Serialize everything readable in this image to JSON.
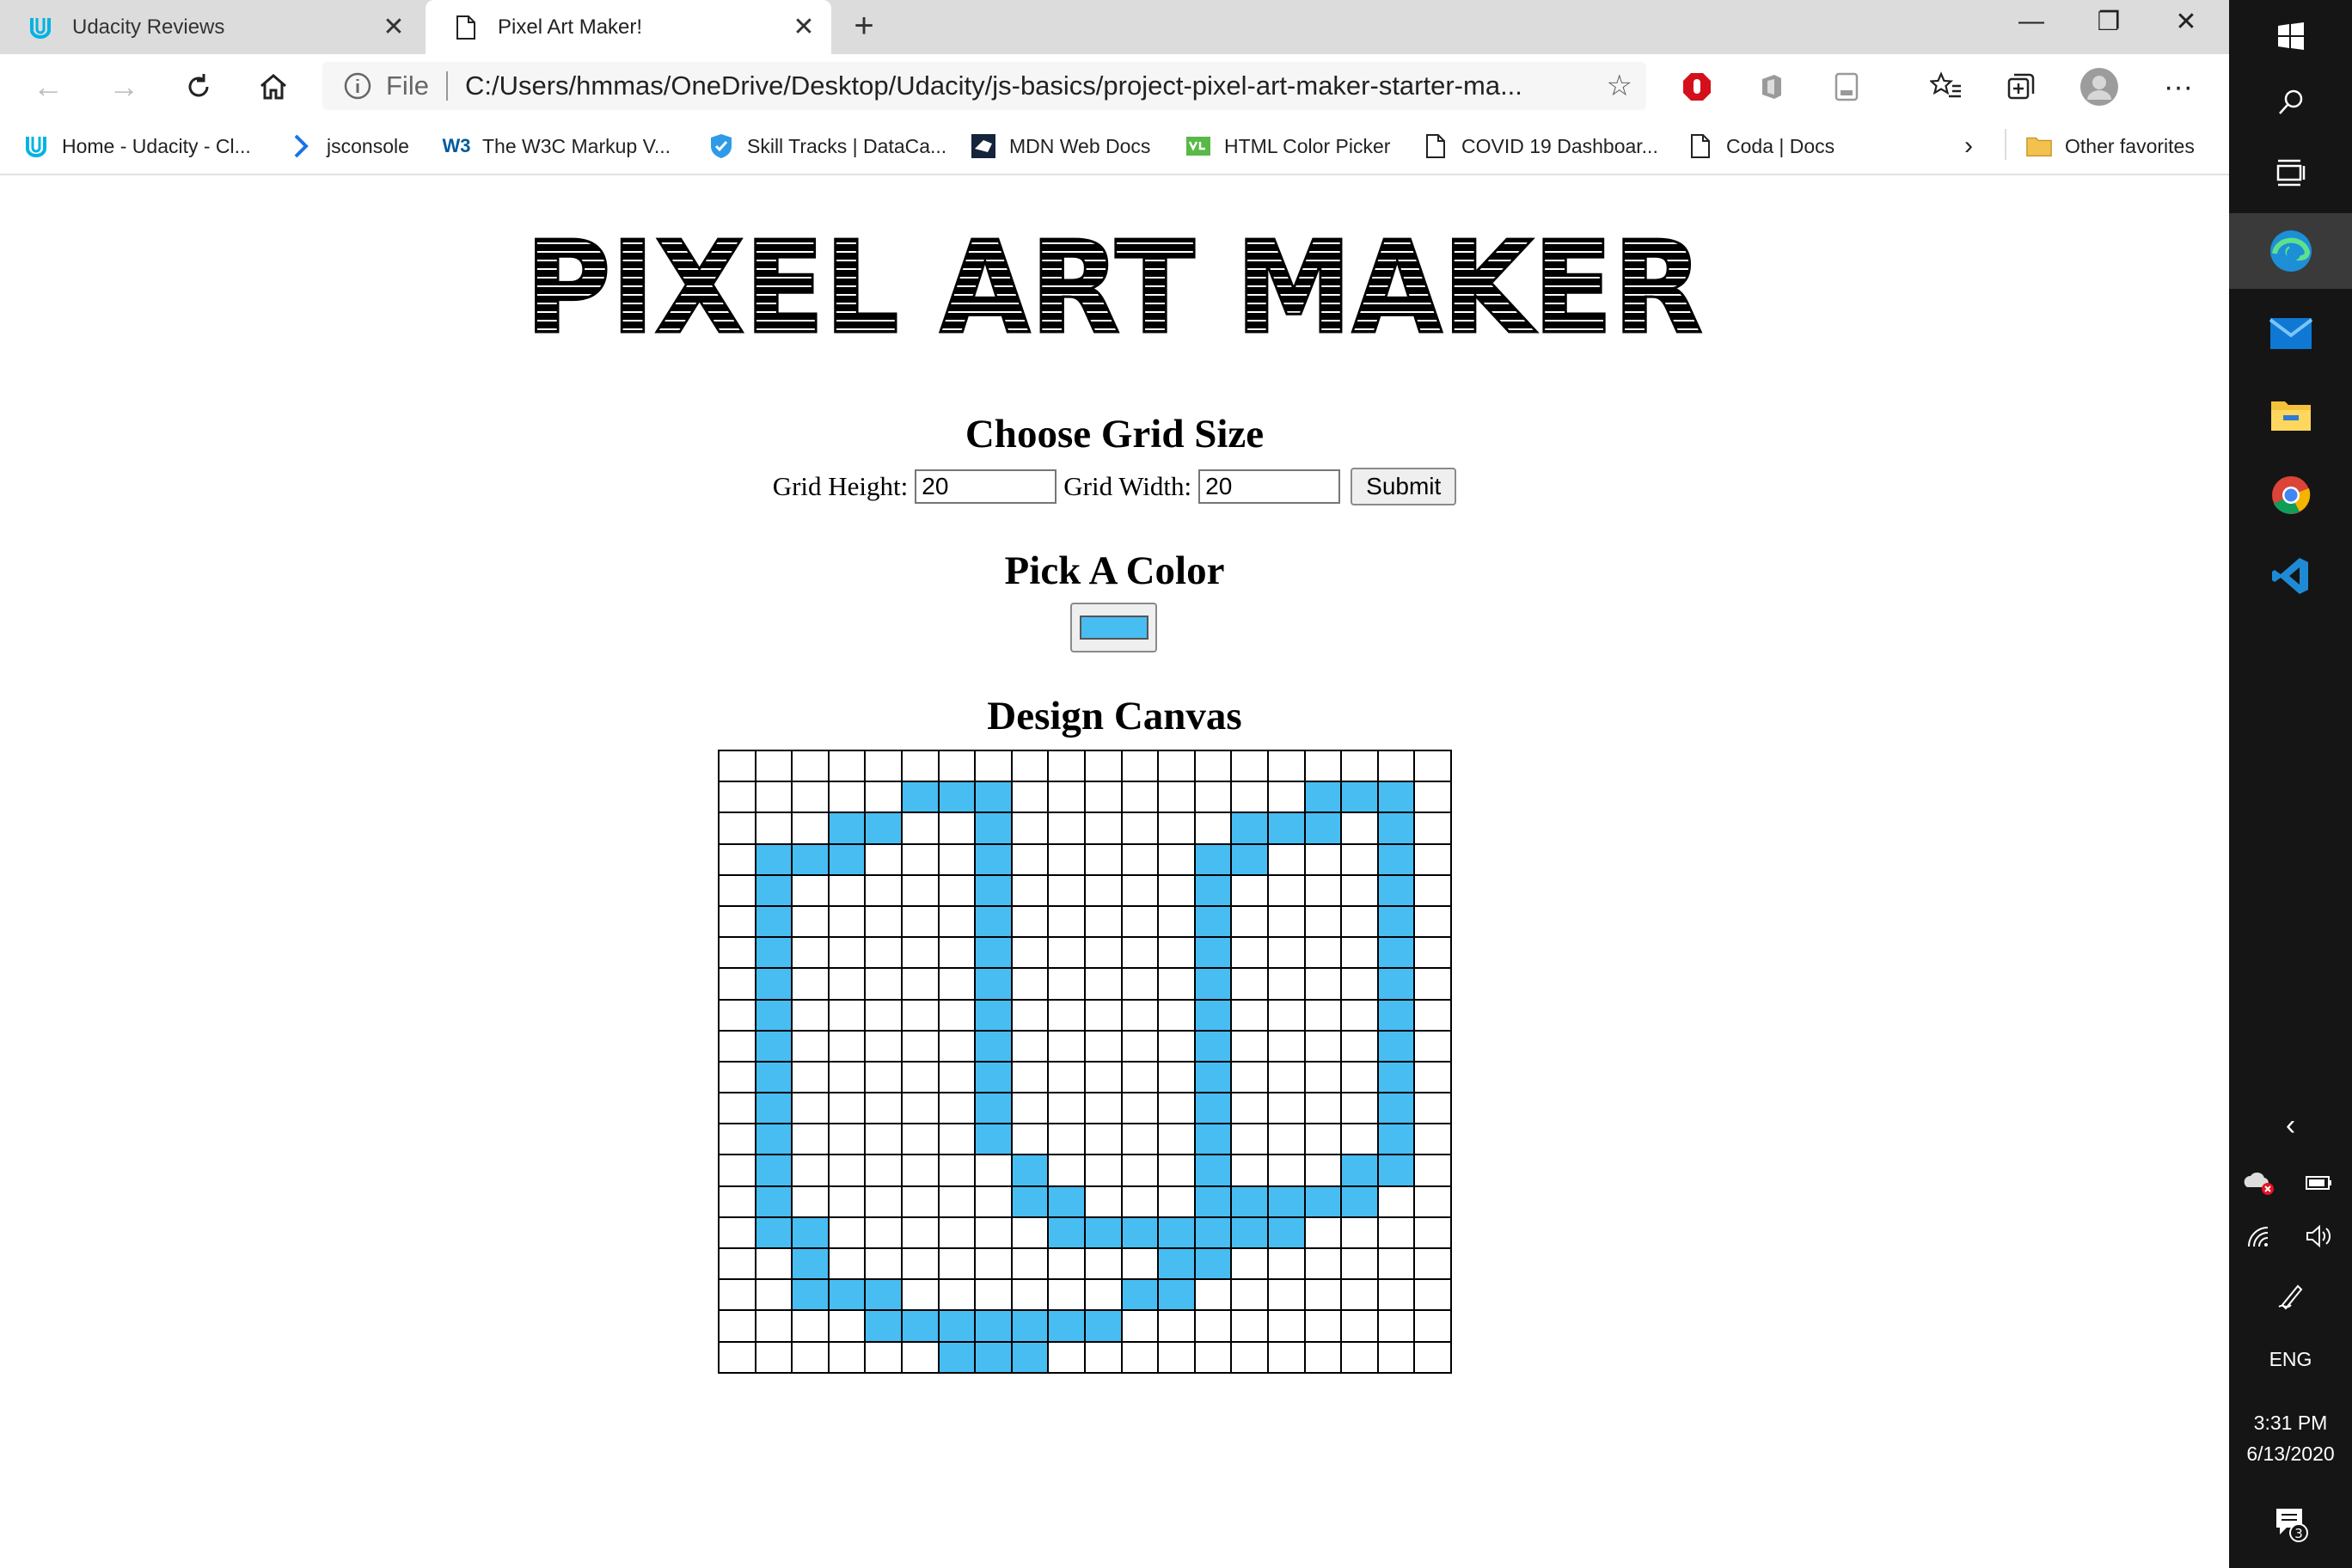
{
  "browser": {
    "tabs": [
      {
        "title": "Udacity Reviews",
        "icon": "udacity-icon",
        "active": false
      },
      {
        "title": "Pixel Art Maker!",
        "icon": "page-icon",
        "active": true
      }
    ],
    "address": {
      "scheme_label": "File",
      "url": "C:/Users/hmmas/OneDrive/Desktop/Udacity/js-basics/project-pixel-art-maker-starter-ma..."
    },
    "bookmarks": [
      {
        "label": "Home - Udacity - Cl...",
        "icon": "udacity-icon"
      },
      {
        "label": "jsconsole",
        "icon": "chevron-right-icon"
      },
      {
        "label": "The W3C Markup V...",
        "icon": "w3c-icon"
      },
      {
        "label": "Skill Tracks | DataCa...",
        "icon": "shield-icon"
      },
      {
        "label": "MDN Web Docs",
        "icon": "mdn-icon"
      },
      {
        "label": "HTML Color Picker",
        "icon": "color-picker-icon"
      },
      {
        "label": "COVID 19 Dashboar...",
        "icon": "page-icon"
      },
      {
        "label": "Coda | Docs",
        "icon": "page-icon"
      }
    ],
    "other_favorites": "Other favorites"
  },
  "page": {
    "logo_text": "PIXEL ART MAKER",
    "grid_heading": "Choose Grid Size",
    "height_label": "Grid Height:",
    "height_value": "20",
    "width_label": "Grid Width:",
    "width_value": "20",
    "submit_label": "Submit",
    "color_heading": "Pick A Color",
    "selected_color": "#48bdf2",
    "canvas_heading": "Design Canvas"
  },
  "grid": {
    "rows": 20,
    "cols": 20,
    "fill_color": "#48bdf2",
    "filled": [
      [
        1,
        5
      ],
      [
        1,
        6
      ],
      [
        1,
        7
      ],
      [
        1,
        16
      ],
      [
        1,
        17
      ],
      [
        1,
        18
      ],
      [
        2,
        3
      ],
      [
        2,
        4
      ],
      [
        2,
        7
      ],
      [
        2,
        14
      ],
      [
        2,
        15
      ],
      [
        2,
        16
      ],
      [
        2,
        18
      ],
      [
        3,
        1
      ],
      [
        3,
        2
      ],
      [
        3,
        3
      ],
      [
        3,
        7
      ],
      [
        3,
        13
      ],
      [
        3,
        14
      ],
      [
        3,
        18
      ],
      [
        4,
        1
      ],
      [
        4,
        7
      ],
      [
        4,
        13
      ],
      [
        4,
        18
      ],
      [
        5,
        1
      ],
      [
        5,
        7
      ],
      [
        5,
        13
      ],
      [
        5,
        18
      ],
      [
        6,
        1
      ],
      [
        6,
        7
      ],
      [
        6,
        13
      ],
      [
        6,
        18
      ],
      [
        7,
        1
      ],
      [
        7,
        7
      ],
      [
        7,
        13
      ],
      [
        7,
        18
      ],
      [
        8,
        1
      ],
      [
        8,
        7
      ],
      [
        8,
        13
      ],
      [
        8,
        18
      ],
      [
        9,
        1
      ],
      [
        9,
        7
      ],
      [
        9,
        13
      ],
      [
        9,
        18
      ],
      [
        10,
        1
      ],
      [
        10,
        7
      ],
      [
        10,
        13
      ],
      [
        10,
        18
      ],
      [
        11,
        1
      ],
      [
        11,
        7
      ],
      [
        11,
        13
      ],
      [
        11,
        18
      ],
      [
        12,
        1
      ],
      [
        12,
        7
      ],
      [
        12,
        13
      ],
      [
        12,
        18
      ],
      [
        13,
        1
      ],
      [
        13,
        8
      ],
      [
        13,
        13
      ],
      [
        13,
        17
      ],
      [
        13,
        18
      ],
      [
        14,
        1
      ],
      [
        14,
        8
      ],
      [
        14,
        9
      ],
      [
        14,
        13
      ],
      [
        14,
        14
      ],
      [
        14,
        15
      ],
      [
        14,
        16
      ],
      [
        14,
        17
      ],
      [
        15,
        1
      ],
      [
        15,
        2
      ],
      [
        15,
        9
      ],
      [
        15,
        10
      ],
      [
        15,
        11
      ],
      [
        15,
        12
      ],
      [
        15,
        13
      ],
      [
        15,
        14
      ],
      [
        15,
        15
      ],
      [
        16,
        2
      ],
      [
        16,
        12
      ],
      [
        16,
        13
      ],
      [
        17,
        2
      ],
      [
        17,
        3
      ],
      [
        17,
        4
      ],
      [
        17,
        11
      ],
      [
        17,
        12
      ],
      [
        18,
        4
      ],
      [
        18,
        5
      ],
      [
        18,
        6
      ],
      [
        18,
        7
      ],
      [
        18,
        8
      ],
      [
        18,
        9
      ],
      [
        18,
        10
      ],
      [
        19,
        6
      ],
      [
        19,
        7
      ],
      [
        19,
        8
      ]
    ]
  },
  "taskbar": {
    "language": "ENG",
    "time": "3:31 PM",
    "date": "6/13/2020",
    "notification_count": "3"
  }
}
